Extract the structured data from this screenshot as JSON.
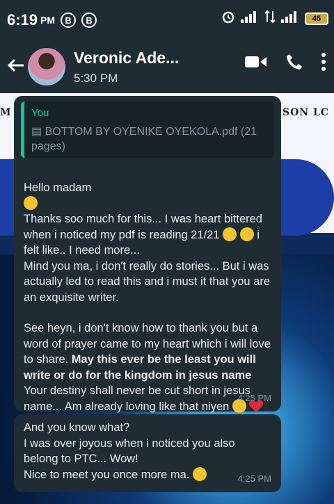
{
  "status_bar": {
    "time": "6:19",
    "ampm": "PM",
    "icon_a": "B",
    "icon_b": "B",
    "battery": "45"
  },
  "chat_header": {
    "contact_name": "Veronic Ade...",
    "last_seen": "5:30 PM"
  },
  "wallpaper": {
    "left_text": "M",
    "right_text": "SON LC"
  },
  "messages": [
    {
      "quote_author": "You",
      "quote_doc": "BOTTOM BY OYENIKE OYEKOLA.pdf (21 pages)",
      "p1": "Hello madam",
      "p2": "Thanks soo much for this... I was heart bittered when i noticed my pdf is reading 21/21",
      "p2b": "i felt like.. I need more...",
      "p3": "Mind you ma, i don't really do stories... But i was actually led to read this and i must it that you are an exquisite writer.",
      "p4": "See heyn, i don't know how to thank you but a word of prayer came to my heart which i will love to share. ",
      "p4_bold": "May this ever be the least you will write or do for the kingdom in jesus name",
      "p5": "Your destiny shall never be cut short in jesus name... Am already loving like that niyen",
      "time": "4:25 PM"
    },
    {
      "p1": "And you know what?",
      "p2": "I was over joyous when i noticed you also belong to PTC... Wow!",
      "p3": "Nice to meet you once more ma.",
      "time": "4:25 PM"
    }
  ]
}
